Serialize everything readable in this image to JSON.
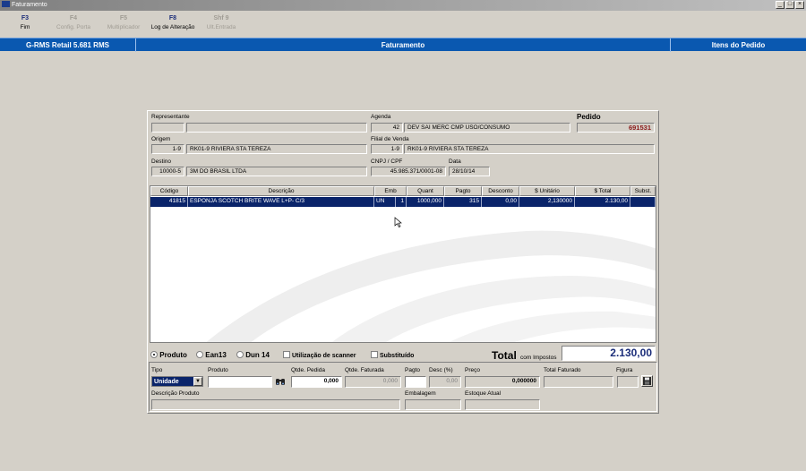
{
  "window": {
    "title": "Faturamento",
    "controls": [
      "_",
      "□",
      "×"
    ]
  },
  "toolbar": [
    {
      "key": "F3",
      "label": "Fim",
      "enabled": true
    },
    {
      "key": "F4",
      "label": "Config. Porta",
      "enabled": false
    },
    {
      "key": "F5",
      "label": "Multiplicador",
      "enabled": false
    },
    {
      "key": "F8",
      "label": "Log de Alteração",
      "enabled": true
    },
    {
      "key": "Shf 9",
      "label": "Ult.Entrada",
      "enabled": false
    }
  ],
  "header": {
    "app_name": "G-RMS Retail 5.681 RMS",
    "title": "Faturamento",
    "section": "Itens do Pedido"
  },
  "form": {
    "representante_label": "Representante",
    "representante_code": "",
    "representante_name": "",
    "agenda_label": "Agenda",
    "agenda_code": "42",
    "agenda_desc": "DEV SAI MERC CMP USO/CONSUMO",
    "pedido_label": "Pedido",
    "pedido_value": "691531",
    "origem_label": "Origem",
    "origem_code": "1-9",
    "origem_name": "RK01-9 RIVIERA STA TEREZA",
    "filial_label": "Filial de Venda",
    "filial_code": "1-9",
    "filial_name": "RK01-9 RIVIERA STA TEREZA",
    "destino_label": "Destino",
    "destino_code": "10000-5",
    "destino_name": "3M DO BRASIL LTDA",
    "cnpj_label": "CNPJ / CPF",
    "cnpj_value": "45.985.371/0001-08",
    "data_label": "Data",
    "data_value": "28/10/14"
  },
  "grid": {
    "columns": [
      "Código",
      "Descrição",
      "Emb",
      "Quant",
      "Pagto",
      "Desconto",
      "$ Unitário",
      "$ Total",
      "Subst."
    ],
    "rows": [
      {
        "codigo": "41815",
        "descricao": "ESPONJA SCOTCH BRITE WAVE L+P- C/3",
        "emb": "UN",
        "emb_qty": "1",
        "quant": "1000,000",
        "pagto": "315",
        "desconto": "0,00",
        "unitario": "2,130000",
        "total": "2.130,00",
        "subst": ""
      }
    ]
  },
  "options": {
    "produto": "Produto",
    "ean13": "Ean13",
    "dun14": "Dun 14",
    "scanner": "Utilização de scanner",
    "substituido": "Substituído"
  },
  "total": {
    "label": "Total",
    "sublabel": "com Impostos",
    "value": "2.130,00"
  },
  "entry": {
    "tipo_label": "Tipo",
    "tipo_value": "Unidade",
    "produto_label": "Produto",
    "produto_value": "",
    "qtde_pedida_label": "Qtde. Pedida",
    "qtde_pedida_value": "0,000",
    "qtde_faturada_label": "Qtde. Faturada",
    "qtde_faturada_value": "0,000",
    "pagto_label": "Pagto",
    "pagto_value": "",
    "desc_label": "Desc (%)",
    "desc_value": "0,00",
    "preco_label": "Preço",
    "preco_value": "0,000000",
    "total_faturado_label": "Total Faturado",
    "total_faturado_value": "",
    "figura_label": "Figura",
    "descricao_label": "Descrição Produto",
    "descricao_value": "",
    "embalagem_label": "Embalagem",
    "embalagem_value": "",
    "estoque_label": "Estoque Atual",
    "estoque_value": ""
  },
  "colors": {
    "header_blue": "#0a58b0",
    "selection": "#0a246a",
    "pedido_red": "#8b1a1a",
    "total_blue": "#1c2e7a"
  }
}
